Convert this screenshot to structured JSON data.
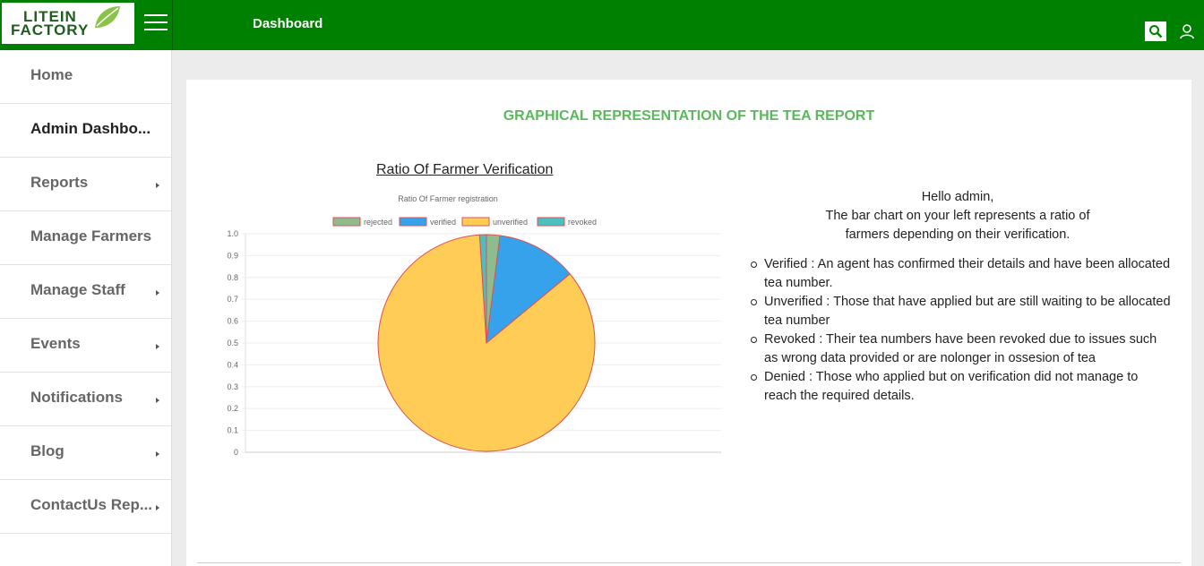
{
  "app": {
    "logo_line1": "LITEIN",
    "logo_line2": "FACTORY",
    "page_title": "Dashboard"
  },
  "topbar": {
    "bg_color": "#008000",
    "menu_icon": "hamburger-icon",
    "search_icon": "search-icon",
    "user_icon": "user-icon"
  },
  "sidebar": {
    "items": [
      {
        "label": "Home",
        "has_arrow": false
      },
      {
        "label": "Admin Dashbo...",
        "has_arrow": false
      },
      {
        "label": "Reports",
        "has_arrow": true
      },
      {
        "label": "Manage Farmers",
        "has_arrow": false
      },
      {
        "label": "Manage Staff",
        "has_arrow": true
      },
      {
        "label": "Events",
        "has_arrow": true
      },
      {
        "label": "Notifications",
        "has_arrow": true
      },
      {
        "label": "Blog",
        "has_arrow": true
      },
      {
        "label": "ContactUs Rep...",
        "has_arrow": true
      }
    ]
  },
  "main": {
    "heading": "GRAPHICAL REPRESENTATION OF THE TEA REPORT",
    "chart_heading": "Ratio Of Farmer Verification",
    "info": {
      "greeting": "Hello admin,",
      "line2": "The bar chart on your left represents a ratio of",
      "line3": "farmers depending on their verification.",
      "bullets": [
        "Verified : An agent has confirmed their details and have been allocated tea number.",
        "Unverified : Those that have applied but are still waiting to be allocated tea number",
        "Revoked : Their tea numbers have been revoked due to issues such as wrong data provided or are nolonger in ossesion of tea",
        "Denied : Those who applied but on verification did not manage to reach the required details."
      ]
    }
  },
  "chart_data": {
    "type": "pie",
    "title": "Ratio Of Farmer registration",
    "legend_position": "top",
    "categories": [
      "rejected",
      "verified",
      "unverified",
      "revoked"
    ],
    "values": [
      0.02,
      0.12,
      0.85,
      0.01
    ],
    "colors": [
      "#8fbc8f",
      "#36a2eb",
      "#ffcd56",
      "#4bc0c0"
    ],
    "y_ticks": [
      "1.0",
      "0.9",
      "0.8",
      "0.7",
      "0.6",
      "0.5",
      "0.4",
      "0.3",
      "0.2",
      "0.1",
      "0"
    ],
    "grid": true
  }
}
